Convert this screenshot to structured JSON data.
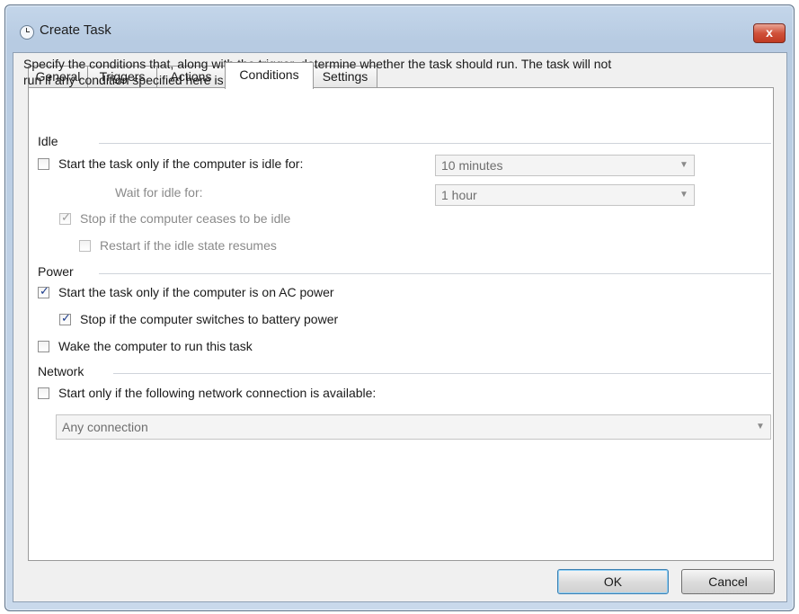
{
  "window": {
    "title": "Create Task",
    "close_label": "x"
  },
  "tabs": [
    {
      "label": "General",
      "active": false
    },
    {
      "label": "Triggers",
      "active": false
    },
    {
      "label": "Actions",
      "active": false
    },
    {
      "label": "Conditions",
      "active": true
    },
    {
      "label": "Settings",
      "active": false
    }
  ],
  "conditions": {
    "description_line1": "Specify the conditions that, along with the trigger, determine whether the task should run.  The task will not",
    "description_line2": "run  if any condition specified here is not true.",
    "idle": {
      "heading": "Idle",
      "start_if_idle_label": "Start the task only if the computer is idle for:",
      "start_if_idle_checked": false,
      "idle_for_value": "10 minutes",
      "wait_for_idle_label": "Wait for idle for:",
      "wait_for_idle_value": "1 hour",
      "stop_if_ceases_label": "Stop if the computer ceases to be idle",
      "stop_if_ceases_checked": true,
      "restart_if_resumes_label": "Restart if the idle state resumes",
      "restart_if_resumes_checked": false
    },
    "power": {
      "heading": "Power",
      "ac_power_label": "Start the task only if the computer is on AC power",
      "ac_power_checked": true,
      "battery_stop_label": "Stop if the computer switches to battery power",
      "battery_stop_checked": true,
      "wake_label": "Wake the computer to run this task",
      "wake_checked": false
    },
    "network": {
      "heading": "Network",
      "network_label": "Start only if the following network connection is available:",
      "network_checked": false,
      "connection_value": "Any connection"
    }
  },
  "buttons": {
    "ok": "OK",
    "cancel": "Cancel"
  },
  "colors": {
    "title_bar": "#b7cbe2",
    "close_button": "#d0513a",
    "check_mark": "#1c3c8c"
  }
}
